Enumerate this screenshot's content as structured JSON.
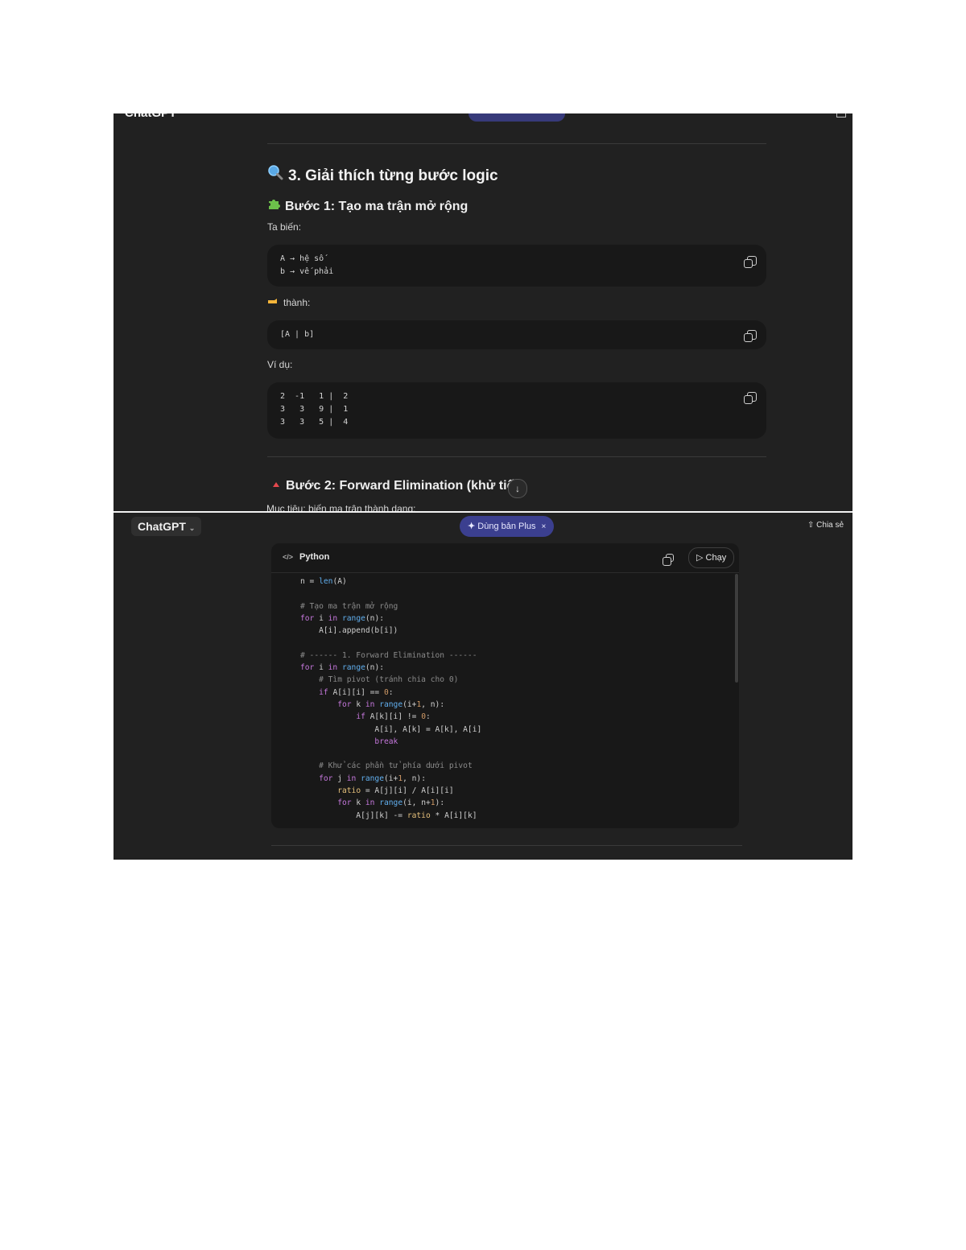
{
  "shot1": {
    "section_title": "3. Giải thích từng bước logic",
    "section_icon": "magnifier-icon",
    "step1": {
      "title": "Bước 1: Tạo ma trận mở rộng",
      "icon": "puzzle-icon"
    },
    "text_ta_bien": "Ta biến:",
    "code1": "A → hệ số\nb → vế phải",
    "text_thanh": "thành:",
    "code2": "[A | b]",
    "text_vidu": "Ví dụ:",
    "code3": "2  -1   1 |  2\n3   3   9 |  1\n3   3   5 |  4",
    "step2": {
      "title": "Bước 2: Forward Elimination (khử tiến",
      "icon": "triangle-icon"
    },
    "cut_text": "Mục tiêu: biến ma trận thành dạng:"
  },
  "shot2": {
    "brand": "ChatGPT",
    "upgrade": "Dùng bản Plus",
    "share": "Chia sẻ",
    "code_lang": "Python",
    "run_label": "Chạy"
  },
  "colors": {
    "page_bg": "#ffffff",
    "app_bg": "#212121",
    "code_bg": "#181818",
    "accent_pill": "#3b3f8f",
    "keyword": "#c678dd",
    "function": "#61afef",
    "number": "#d19a66"
  }
}
